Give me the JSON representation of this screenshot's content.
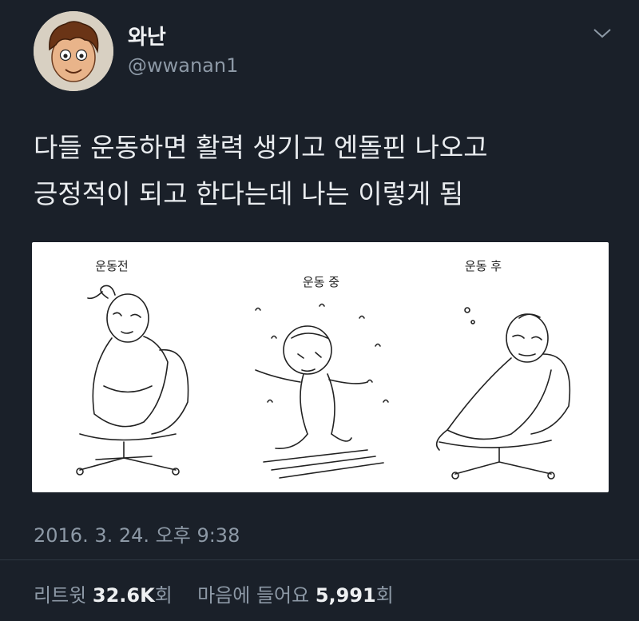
{
  "author": {
    "display_name": "와난",
    "handle": "@wwanan1"
  },
  "tweet": {
    "text_line1": "다들 운동하면 활력 생기고 엔돌핀 나오고",
    "text_line2": "긍정적이 되고 한다는데 나는 이렇게 됨",
    "timestamp": "2016. 3. 24. 오후 9:38"
  },
  "media": {
    "panels": [
      {
        "caption": "운동전"
      },
      {
        "caption": "운동 중"
      },
      {
        "caption": "운동 후"
      }
    ]
  },
  "stats": {
    "retweet_label": "리트윗",
    "retweet_count": "32.6K",
    "retweet_unit": "회",
    "like_label": "마음에 들어요",
    "like_count": "5,991",
    "like_unit": "회"
  },
  "icons": {
    "caret": "chevron-down-icon"
  },
  "colors": {
    "background": "#1a2029",
    "text": "#e9ecef",
    "muted": "#8d99a6"
  }
}
